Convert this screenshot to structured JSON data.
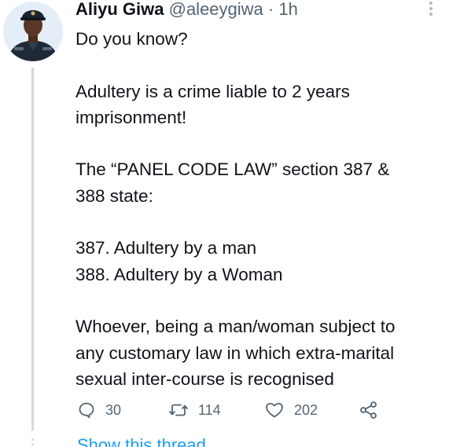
{
  "author": {
    "display_name": "Aliyu Giwa",
    "handle": "@aleeygiwa",
    "separator": "·",
    "time": "1h"
  },
  "tweet_lines": [
    "Do you know?",
    "",
    "Adultery is a crime liable to 2 years",
    "imprisonment!",
    "",
    "The “PANEL CODE LAW” section 387 &",
    "388 state:",
    "",
    "387. Adultery by a man",
    "388. Adultery by a Woman",
    "",
    "Whoever, being a man/woman subject to",
    "any customary law in which extra-marital",
    "sexual inter-course is recognised"
  ],
  "actions": {
    "reply": {
      "icon": "reply-icon",
      "count": "30"
    },
    "retweet": {
      "icon": "retweet-icon",
      "count": "114"
    },
    "like": {
      "icon": "heart-icon",
      "count": "202"
    },
    "share": {
      "icon": "share-icon"
    }
  },
  "show_thread": "Show this thread",
  "colors": {
    "text": "#0f1419",
    "muted": "#536471",
    "link": "#1d9bf0",
    "thread_line": "#cfd9de"
  }
}
